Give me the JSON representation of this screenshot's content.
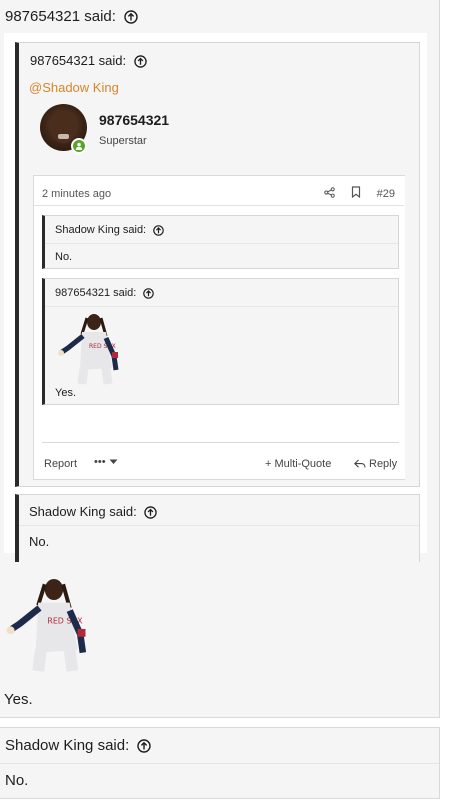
{
  "outer_quote": {
    "author_label": "987654321 said:",
    "body_text": "Yes."
  },
  "embedded_post": {
    "quote_author_label": "987654321 said:",
    "mention": "@Shadow King",
    "poster": {
      "name": "987654321",
      "title": "Superstar",
      "online": true
    },
    "meta": {
      "time": "2 minutes ago",
      "post_number": "#29"
    },
    "quotes": [
      {
        "author_label": "Shadow King said:",
        "text": "No."
      },
      {
        "author_label": "987654321 said:",
        "text": "Yes."
      }
    ],
    "footer": {
      "report": "Report",
      "more": "•••",
      "multi_quote": "+ Multi-Quote",
      "reply": "Reply"
    }
  },
  "shadow_quote": {
    "author_label": "Shadow King said:",
    "text": "No."
  },
  "last_quote": {
    "author_label": "Shadow King said:",
    "text": "No."
  },
  "colors": {
    "mention": "#d8852b",
    "online": "#5aa32a",
    "quote_border": "#2a2a2a",
    "quote_bg": "#f5f5f5"
  },
  "icons": [
    "arrow-up-circle-icon",
    "share-icon",
    "bookmark-icon",
    "user-icon",
    "chevron-down-icon",
    "reply-icon"
  ]
}
